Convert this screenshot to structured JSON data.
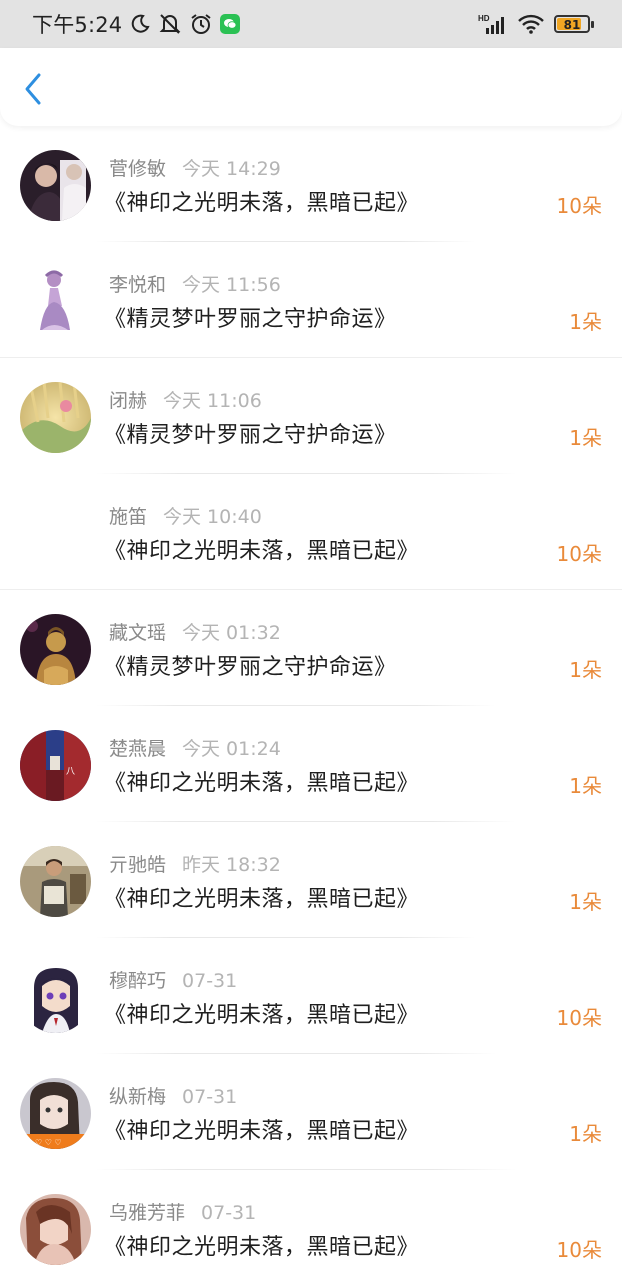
{
  "status_bar": {
    "time": "下午5:24",
    "network": "HD",
    "battery": "81",
    "icons": [
      "moon-icon",
      "mute-icon",
      "alarm-icon",
      "wechat-icon",
      "signal-icon",
      "wifi-icon",
      "battery-icon"
    ]
  },
  "header": {
    "back_icon": "chevron-left-icon",
    "accent_color": "#2e8fe0"
  },
  "colors": {
    "name": "#8a8a8a",
    "time": "#b4b4b4",
    "title": "#1f1f1f",
    "count": "#e98a3a"
  },
  "gifts": [
    {
      "name": "菅修敏",
      "time": "今天 14:29",
      "title": "《神印之光明未落，黑暗已起》",
      "count": "10朵",
      "has_avatar": true
    },
    {
      "name": "李悦和",
      "time": "今天 11:56",
      "title": "《精灵梦叶罗丽之守护命运》",
      "count": "1朵",
      "has_avatar": true
    },
    {
      "name": "闭赫",
      "time": "今天 11:06",
      "title": "《精灵梦叶罗丽之守护命运》",
      "count": "1朵",
      "has_avatar": true
    },
    {
      "name": "施笛",
      "time": "今天 10:40",
      "title": "《神印之光明未落，黑暗已起》",
      "count": "10朵",
      "has_avatar": false
    },
    {
      "name": "藏文瑶",
      "time": "今天 01:32",
      "title": "《精灵梦叶罗丽之守护命运》",
      "count": "1朵",
      "has_avatar": true
    },
    {
      "name": "楚燕晨",
      "time": "今天 01:24",
      "title": "《神印之光明未落，黑暗已起》",
      "count": "1朵",
      "has_avatar": true
    },
    {
      "name": "亓驰皓",
      "time": "昨天 18:32",
      "title": "《神印之光明未落，黑暗已起》",
      "count": "1朵",
      "has_avatar": true
    },
    {
      "name": "穆醉巧",
      "time": "07-31",
      "title": "《神印之光明未落，黑暗已起》",
      "count": "10朵",
      "has_avatar": true
    },
    {
      "name": "纵新梅",
      "time": "07-31",
      "title": "《神印之光明未落，黑暗已起》",
      "count": "1朵",
      "has_avatar": true
    },
    {
      "name": "乌雅芳菲",
      "time": "07-31",
      "title": "《神印之光明未落，黑暗已起》",
      "count": "10朵",
      "has_avatar": true
    }
  ]
}
